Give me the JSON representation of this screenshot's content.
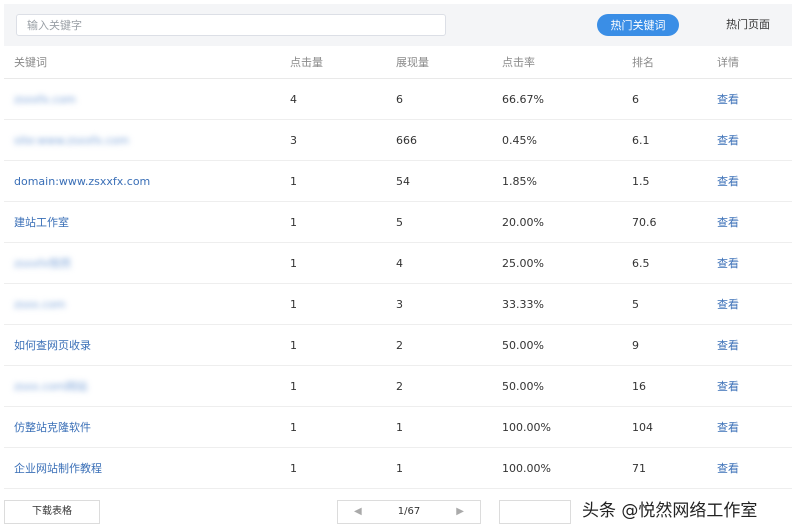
{
  "search": {
    "placeholder": "输入关键字"
  },
  "tabs": {
    "hot_keywords": "热门关键词",
    "hot_pages": "热门页面"
  },
  "table": {
    "headers": [
      "关键词",
      "点击量",
      "展现量",
      "点击率",
      "排名",
      "详情"
    ],
    "rows": [
      {
        "keyword": "zsxxfx.com",
        "blurred": true,
        "clicks": "4",
        "impressions": "6",
        "ctr": "66.67%",
        "rank": "6",
        "detail": "查看"
      },
      {
        "keyword": "site:www.zsxxfx.com",
        "blurred": true,
        "clicks": "3",
        "impressions": "666",
        "ctr": "0.45%",
        "rank": "6.1",
        "detail": "查看"
      },
      {
        "keyword": "domain:www.zsxxfx.com",
        "blurred": false,
        "clicks": "1",
        "impressions": "54",
        "ctr": "1.85%",
        "rank": "1.5",
        "detail": "查看"
      },
      {
        "keyword": "建站工作室",
        "blurred": false,
        "clicks": "1",
        "impressions": "5",
        "ctr": "20.00%",
        "rank": "70.6",
        "detail": "查看"
      },
      {
        "keyword": "zsxxfx悦然",
        "blurred": true,
        "clicks": "1",
        "impressions": "4",
        "ctr": "25.00%",
        "rank": "6.5",
        "detail": "查看"
      },
      {
        "keyword": "zsxx.com",
        "blurred": true,
        "clicks": "1",
        "impressions": "3",
        "ctr": "33.33%",
        "rank": "5",
        "detail": "查看"
      },
      {
        "keyword": "如何查网页收录",
        "blurred": false,
        "clicks": "1",
        "impressions": "2",
        "ctr": "50.00%",
        "rank": "9",
        "detail": "查看"
      },
      {
        "keyword": "zsxx.com网站",
        "blurred": true,
        "clicks": "1",
        "impressions": "2",
        "ctr": "50.00%",
        "rank": "16",
        "detail": "查看"
      },
      {
        "keyword": "仿整站克隆软件",
        "blurred": false,
        "clicks": "1",
        "impressions": "1",
        "ctr": "100.00%",
        "rank": "104",
        "detail": "查看"
      },
      {
        "keyword": "企业网站制作教程",
        "blurred": false,
        "clicks": "1",
        "impressions": "1",
        "ctr": "100.00%",
        "rank": "71",
        "detail": "查看"
      }
    ]
  },
  "footer": {
    "download": "下载表格",
    "page": "1/67"
  },
  "watermark": "头条 @悦然网络工作室"
}
